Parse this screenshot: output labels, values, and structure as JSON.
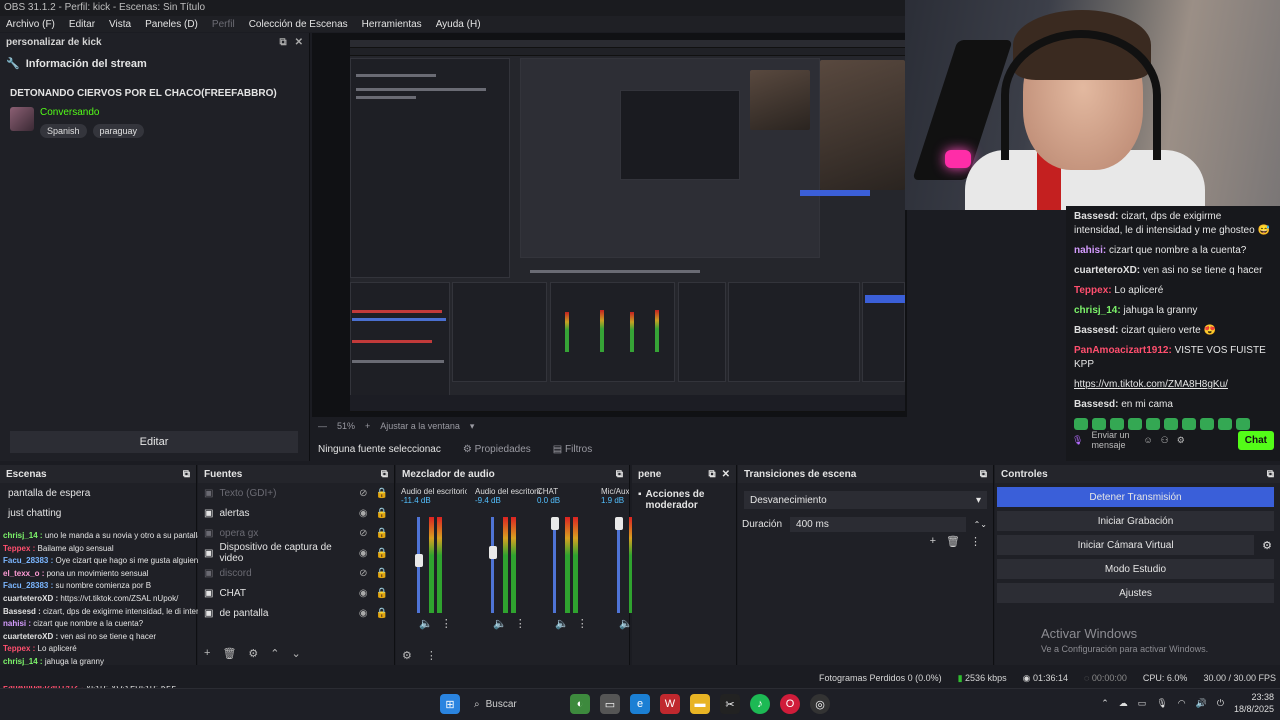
{
  "window_title": "OBS 31.1.2 - Perfil: kick - Escenas: Sin Título",
  "menu": [
    "Archivo (F)",
    "Editar",
    "Vista",
    "Paneles (D)",
    "Perfil",
    "Colección de Escenas",
    "Herramientas",
    "Ayuda (H)"
  ],
  "kick_dock": {
    "title": "personalizar de kick",
    "section": "Información del stream",
    "stream_title": "DETONANDO CIERVOS POR EL CHACO(FREEFABBRO)",
    "category": "Conversando",
    "tags": [
      "Spanish",
      "paraguay"
    ],
    "edit_button": "Editar"
  },
  "kick_chat": {
    "messages": [
      {
        "user": "Bassesd:",
        "text": "cizart, dps de exigirme intensidad, le di intensidad y me ghosteo 😅",
        "color": "#e0e0e0"
      },
      {
        "user": "nahisi:",
        "text": "cizart que nombre a la cuenta?",
        "color": "#d59cff"
      },
      {
        "user": "cuarteteroXD:",
        "text": "ven asi no se tiene q hacer",
        "color": "#e0e0e0"
      },
      {
        "user": "Teppex:",
        "text": "Lo apliceré",
        "color": "#ff4f6e"
      },
      {
        "user": "chrisj_14:",
        "text": "jahuga la granny",
        "color": "#7cf36a"
      },
      {
        "user": "Bassesd:",
        "text": "cizart quiero verte 😍",
        "color": "#e0e0e0"
      },
      {
        "user": "PanAmoacizart1912:",
        "text": "VISTE VOS FUISTE KPP",
        "color": "#ff4f6e"
      },
      {
        "user": "",
        "text": "https://vm.tiktok.com/ZMA8H8gKu/",
        "color": "#e0e0e0"
      },
      {
        "user": "Bassesd:",
        "text": "en mi cama",
        "color": "#e0e0e0"
      }
    ],
    "input_placeholder": "Enviar un mensaje",
    "send_label": "Chat"
  },
  "preview": {
    "zoom": "51%",
    "fit_label": "Ajustar a la ventana",
    "no_source": "Ninguna fuente seleccionac",
    "properties": "Propiedades",
    "filters": "Filtros"
  },
  "scenes": {
    "title": "Escenas",
    "items": [
      "pantalla de espera",
      "just chatting"
    ]
  },
  "sources": {
    "title": "Fuentes",
    "items": [
      {
        "name": "Texto (GDI+)",
        "dim": true
      },
      {
        "name": "alertas",
        "dim": false
      },
      {
        "name": "opera gx",
        "dim": true
      },
      {
        "name": "Dispositivo de captura de video",
        "dim": false
      },
      {
        "name": "discord",
        "dim": true
      },
      {
        "name": "CHAT",
        "dim": false
      },
      {
        "name": "de pantalla",
        "dim": false
      }
    ]
  },
  "overlay_chat": [
    {
      "user": "chrisj_14 :",
      "text": "uno le manda a su novia y otro a su pantalla",
      "color": "#7cf36a"
    },
    {
      "user": "Teppex :",
      "text": "Bailame algo sensual",
      "color": "#ff4f6e"
    },
    {
      "user": "Facu_28383 :",
      "text": "Oye cizart que hago si me gusta alguien?",
      "color": "#7bb6ff"
    },
    {
      "user": "el_texx_o :",
      "text": "pona un movimiento sensual",
      "color": "#ff9bd5"
    },
    {
      "user": "Facu_28383 :",
      "text": "su nombre comienza por B",
      "color": "#7bb6ff"
    },
    {
      "user": "cuarteteroXD :",
      "text": "https://vt.tiktok.com/ZSAL nUpok/",
      "color": "#e0e0e0"
    },
    {
      "user": "Bassesd :",
      "text": "cizart, dps de exigirme intensidad, le di intensidad y me ghosteo 😅",
      "color": "#e0e0e0"
    },
    {
      "user": "nahisi :",
      "text": "cizart que nombre a la cuenta?",
      "color": "#d59cff"
    },
    {
      "user": "cuarteteroXD :",
      "text": "ven asi no se tiene q hacer",
      "color": "#e0e0e0"
    },
    {
      "user": "Teppex :",
      "text": "Lo apliceré",
      "color": "#ff4f6e"
    },
    {
      "user": "chrisj_14 :",
      "text": "jahuga la granny",
      "color": "#7cf36a"
    },
    {
      "user": "Bassesd :",
      "text": "cizart quiero verte 😍",
      "color": "#e0e0e0"
    },
    {
      "user": "PanAmoacizart1912 :",
      "text": "VISTE VOS FUISTE KPP",
      "color": "#ff4f6e"
    },
    {
      "user": "",
      "text": "https://vm.tiktok.com/ZMA8H8gKu/",
      "color": "#e0e0e0"
    },
    {
      "user": "Bassesd :",
      "text": "en mi cama",
      "color": "#e0e0e0"
    }
  ],
  "mixer": {
    "title": "Mezclador de audio",
    "channels": [
      {
        "name": "Audio del escritorio",
        "db": "-11.4 dB",
        "level": 0.55
      },
      {
        "name": "Audio del escritorio",
        "db": "-9.4 dB",
        "level": 0.65
      },
      {
        "name": "CHAT",
        "db": "0.0 dB",
        "level": 1.0
      },
      {
        "name": "Mic/Aux",
        "db": "1.9 dB",
        "level": 1.0
      }
    ]
  },
  "pene_dock": {
    "title": "pene",
    "item": "Acciones de moderador"
  },
  "transitions": {
    "title": "Transiciones de escena",
    "selected": "Desvanecimiento",
    "duration_label": "Duración",
    "duration_value": "400 ms"
  },
  "controls": {
    "title": "Controles",
    "buttons": [
      "Detener Transmisión",
      "Iniciar Grabación",
      "Iniciar Cámara Virtual",
      "Modo Estudio",
      "Ajustes"
    ]
  },
  "watermark": {
    "line1": "Activar Windows",
    "line2": "Ve a Configuración para activar Windows."
  },
  "status": {
    "dropped": "Fotogramas Perdidos 0 (0.0%)",
    "bitrate": "2536 kbps",
    "live_time": "01:36:14",
    "rec_time": "00:00:00",
    "cpu": "CPU: 6.0%",
    "fps": "30.00 / 30.00 FPS"
  },
  "taskbar": {
    "search": "Buscar",
    "time": "23:38",
    "date": "18/8/2025"
  },
  "colors": {
    "kick_green": "#53fc18",
    "obs_blue": "#3a5fd9",
    "bg": "#1f2026"
  }
}
